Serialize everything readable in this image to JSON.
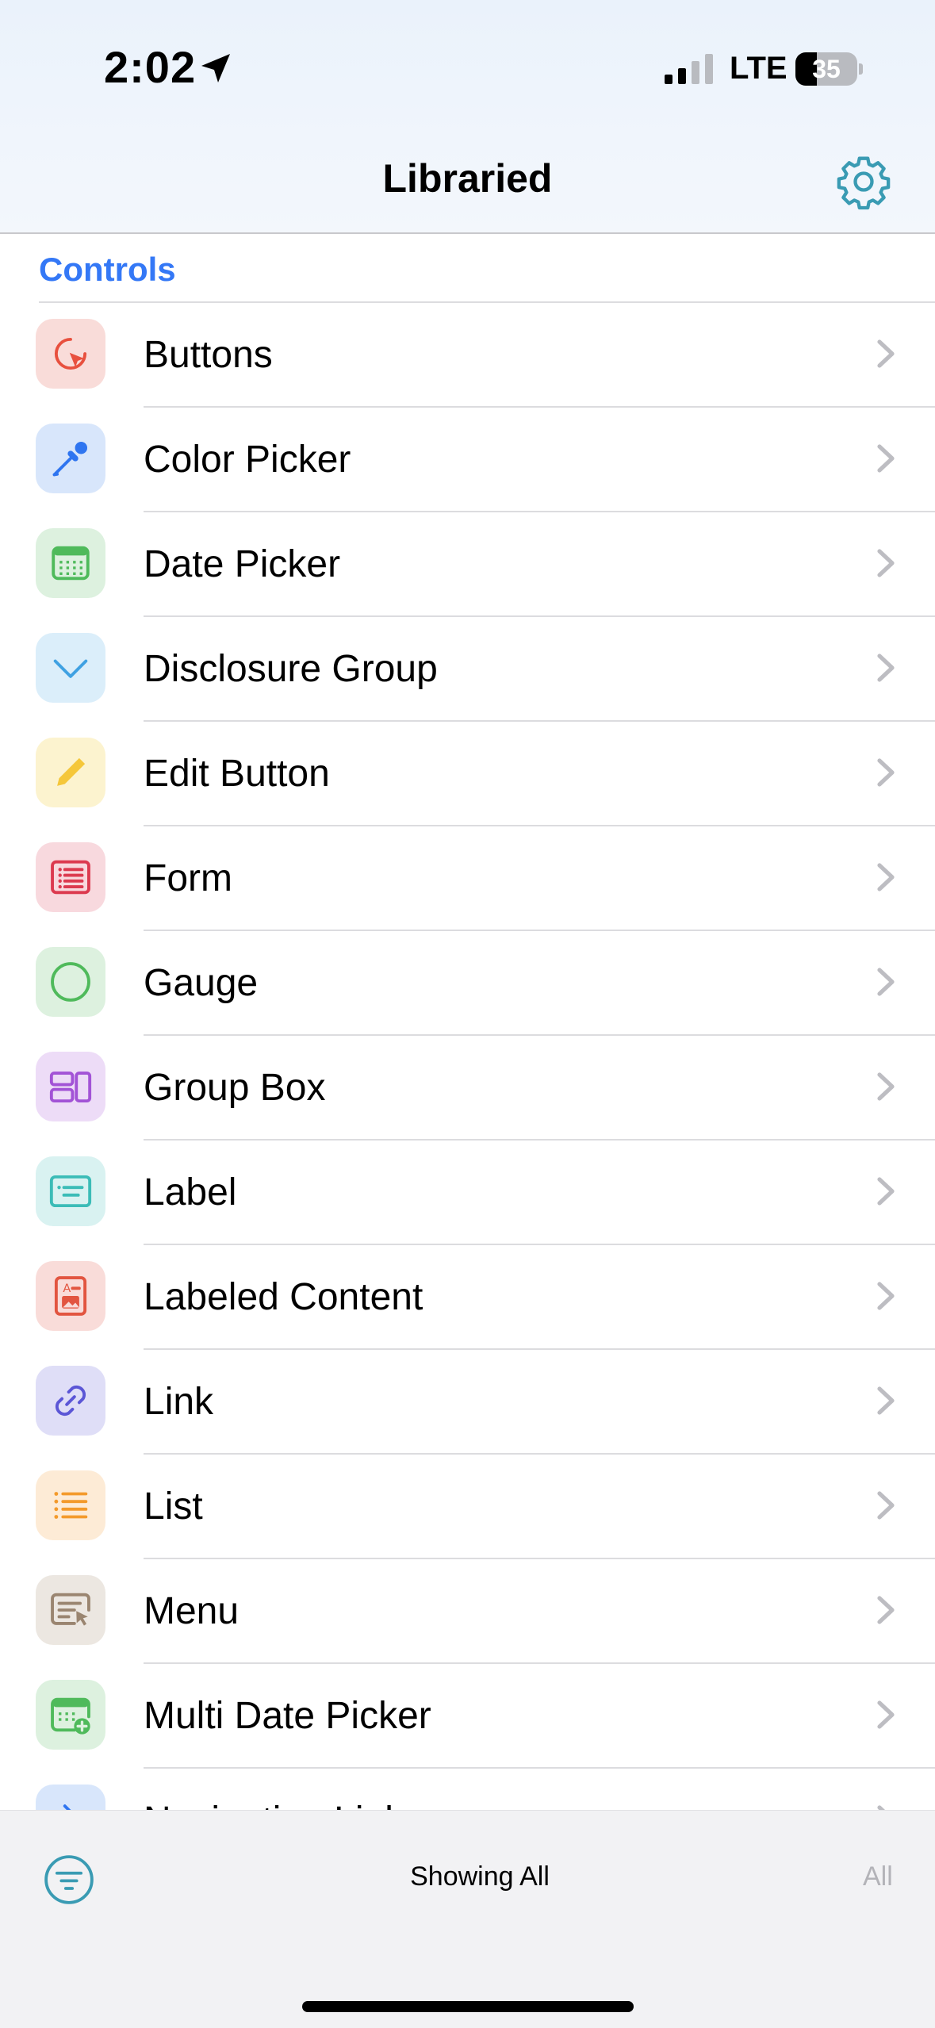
{
  "status_bar": {
    "time": "2:02",
    "network": "LTE",
    "battery": "35",
    "battery_level": 0.35
  },
  "nav": {
    "title": "Libraried",
    "settings_icon": "gear-icon"
  },
  "section": {
    "header": "Controls"
  },
  "items": [
    {
      "label": "Buttons",
      "icon": "cursor-click-icon",
      "color": "#e8503e",
      "bg": "#f9dcd9"
    },
    {
      "label": "Color Picker",
      "icon": "eyedropper-icon",
      "color": "#2f75f0",
      "bg": "#d8e6fb"
    },
    {
      "label": "Date Picker",
      "icon": "calendar-icon",
      "color": "#4fba5b",
      "bg": "#ddf1df"
    },
    {
      "label": "Disclosure Group",
      "icon": "chevron-down-icon",
      "color": "#3fa1e2",
      "bg": "#dbeefa"
    },
    {
      "label": "Edit Button",
      "icon": "pencil-icon",
      "color": "#f5c73a",
      "bg": "#fcf3cf"
    },
    {
      "label": "Form",
      "icon": "form-icon",
      "color": "#dc3a4f",
      "bg": "#f8d9de"
    },
    {
      "label": "Gauge",
      "icon": "circle-icon",
      "color": "#4fba5b",
      "bg": "#ddf1df"
    },
    {
      "label": "Group Box",
      "icon": "group-box-icon",
      "color": "#a253d6",
      "bg": "#eddcf7"
    },
    {
      "label": "Label",
      "icon": "label-icon",
      "color": "#3bbcb7",
      "bg": "#d9f2f1"
    },
    {
      "label": "Labeled Content",
      "icon": "labeled-content-icon",
      "color": "#e25540",
      "bg": "#f9dcd9"
    },
    {
      "label": "Link",
      "icon": "link-icon",
      "color": "#5b56d6",
      "bg": "#dfdef7"
    },
    {
      "label": "List",
      "icon": "list-icon",
      "color": "#f39a2b",
      "bg": "#fdebd6"
    },
    {
      "label": "Menu",
      "icon": "menu-icon",
      "color": "#9a8570",
      "bg": "#ece7e1"
    },
    {
      "label": "Multi Date Picker",
      "icon": "calendar-plus-icon",
      "color": "#4fba5b",
      "bg": "#ddf1df"
    },
    {
      "label": "Navigation Link",
      "icon": "navigation-link-icon",
      "color": "#2f75f0",
      "bg": "#d8e6fb"
    }
  ],
  "toolbar": {
    "status": "Showing All",
    "all_label": "All",
    "filter_icon": "filter-icon"
  }
}
